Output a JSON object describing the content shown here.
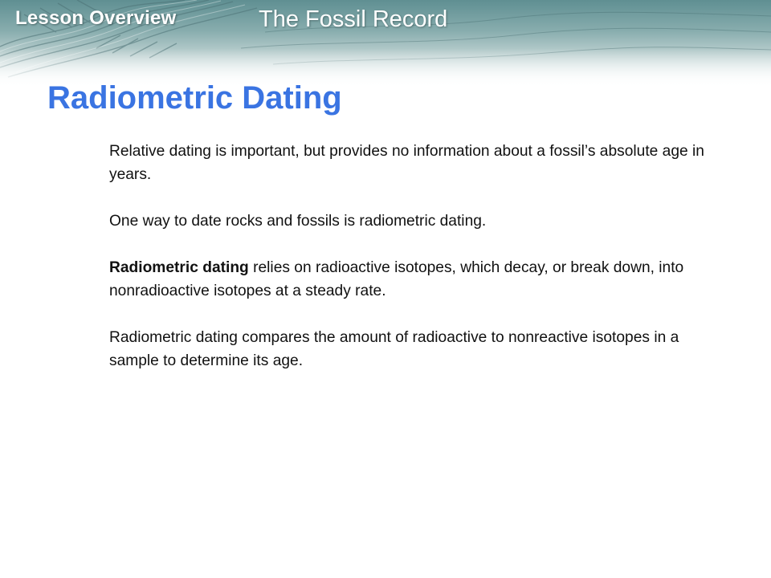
{
  "header": {
    "lesson_label": "Lesson Overview",
    "lesson_title": "The Fossil Record",
    "band_color": "#6f9a9c"
  },
  "slide": {
    "title": "Radiometric Dating",
    "title_color": "#3a74e2",
    "paragraphs": [
      {
        "text": "Relative dating is important, but provides no information about a fossil’s absolute age in years."
      },
      {
        "text": "One way to date rocks and fossils is radiometric dating."
      },
      {
        "term": "Radiometric dating",
        "text": " relies on radioactive isotopes, which decay, or break down, into nonradioactive isotopes at a steady rate."
      },
      {
        "text": "Radiometric dating compares the amount of radioactive to nonreactive isotopes in a sample to determine its age."
      }
    ]
  }
}
